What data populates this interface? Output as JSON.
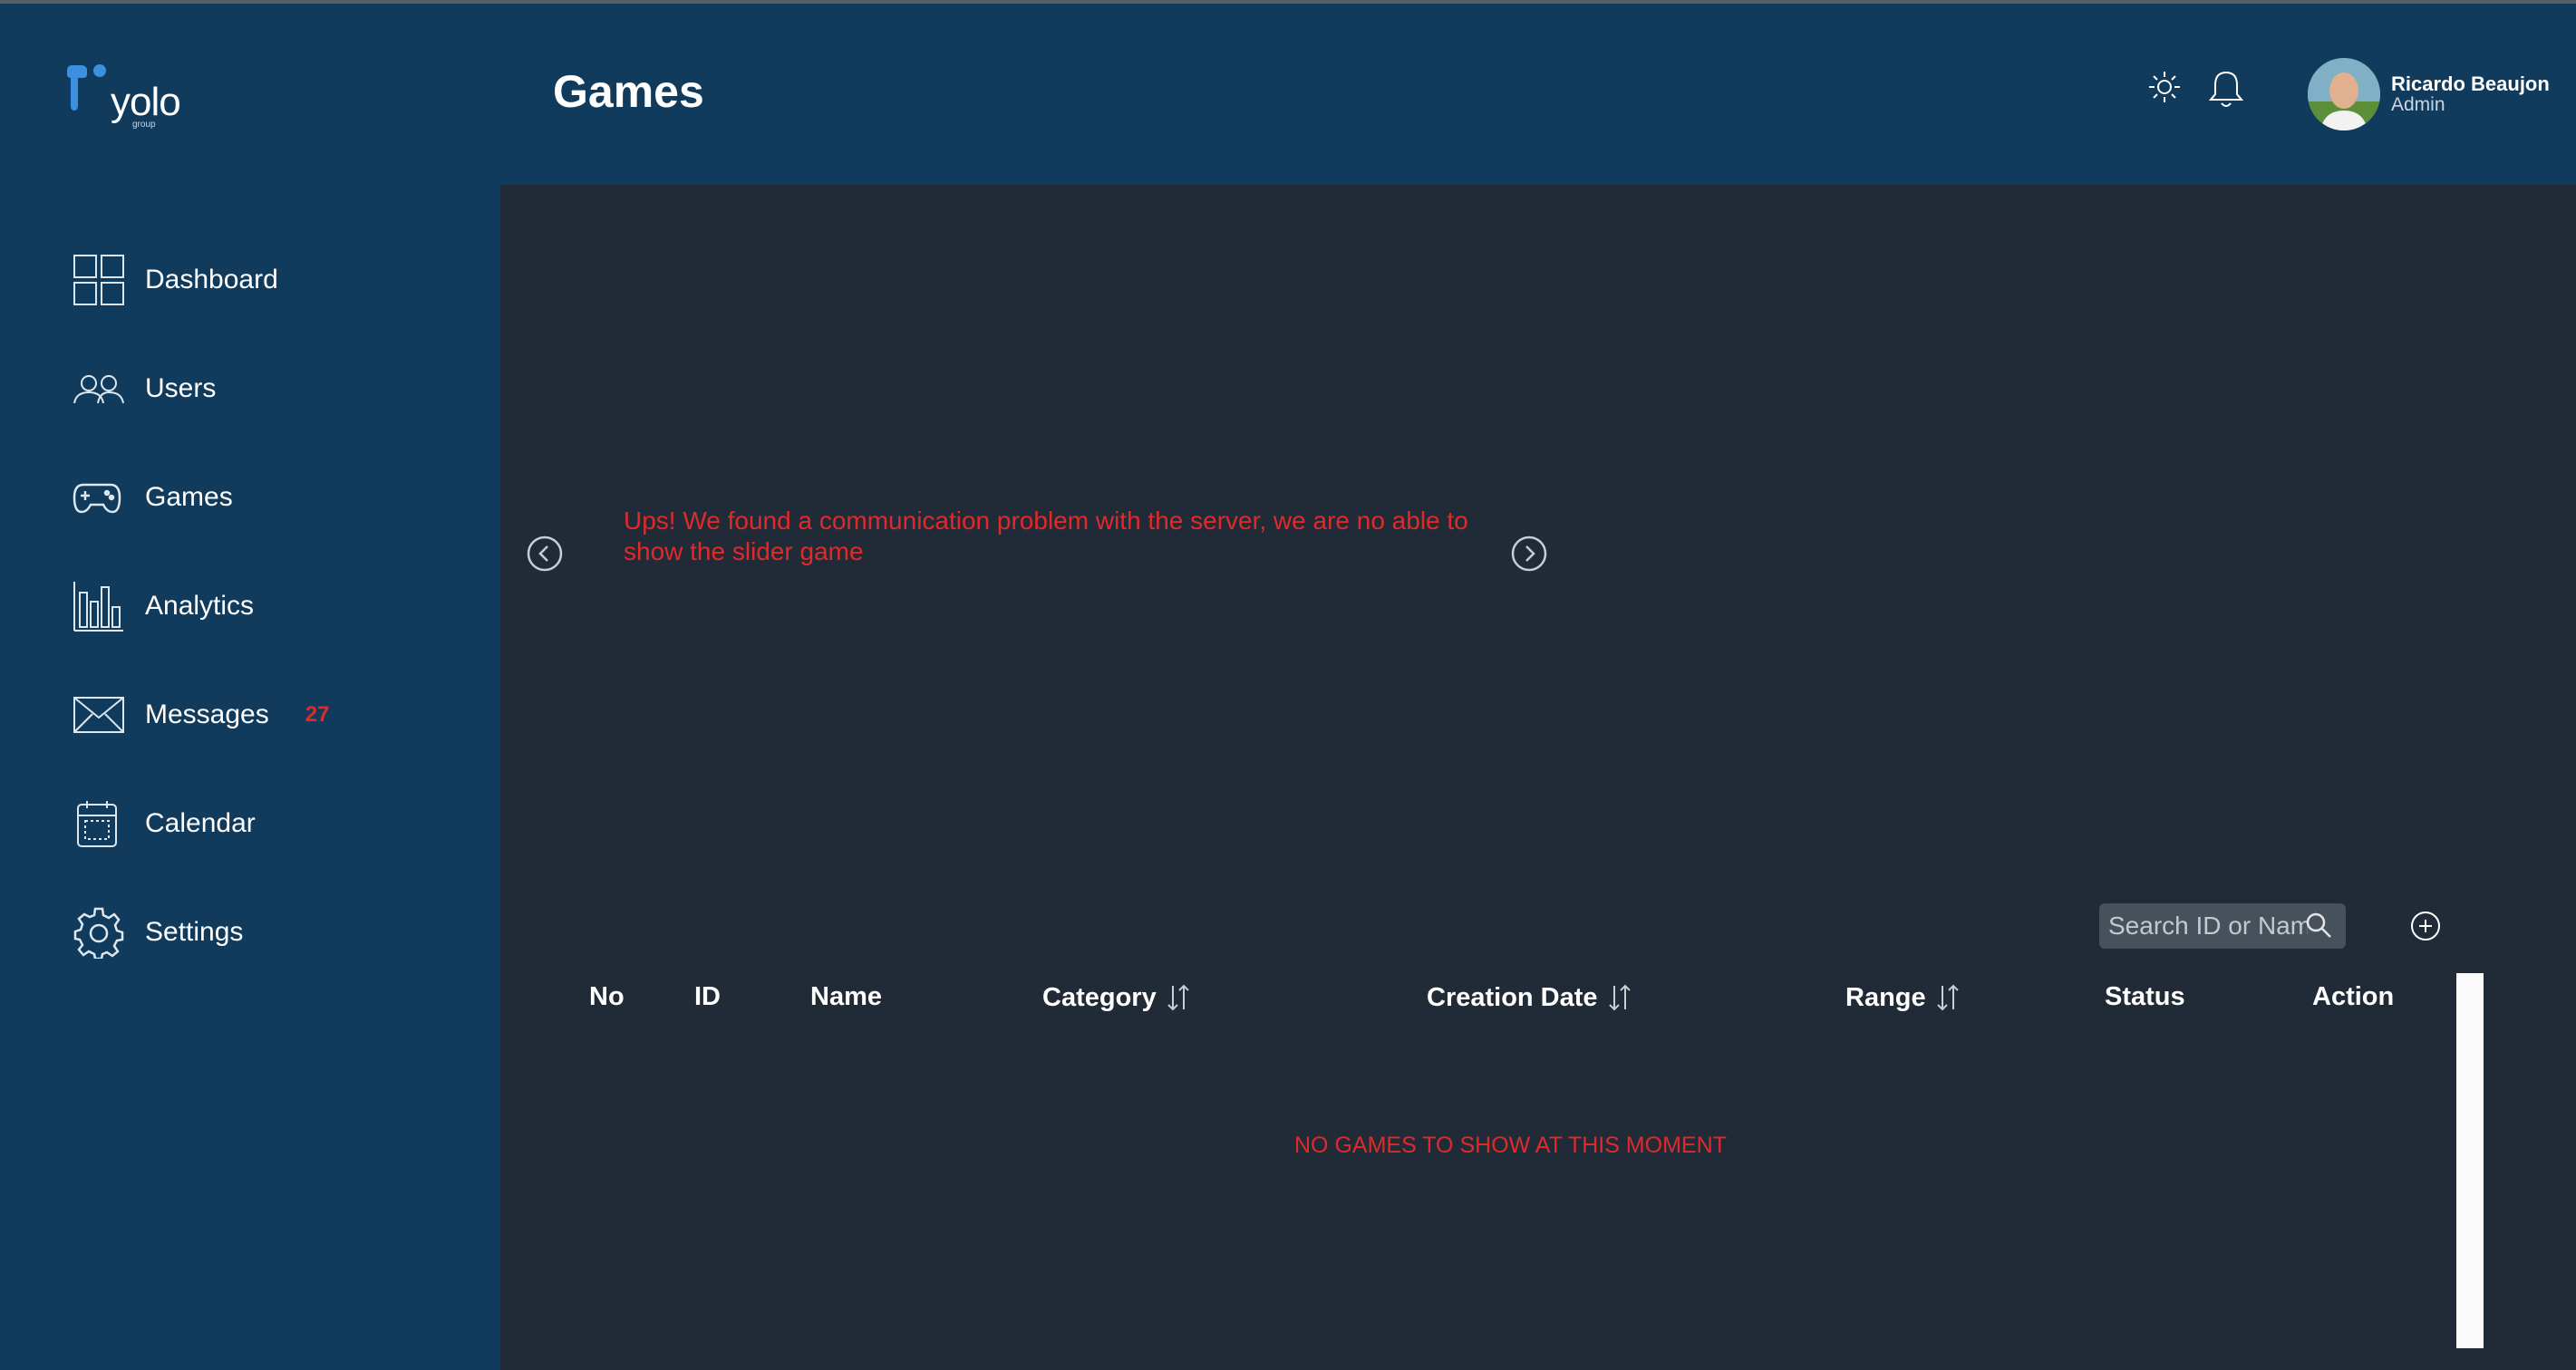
{
  "brand": {
    "name": "yolo",
    "sub": "group",
    "accent": "#3d8fe0"
  },
  "colors": {
    "sidebar": "#113b5c",
    "content": "#202b37",
    "error": "#e02a2a"
  },
  "header": {
    "title": "Games",
    "theme_icon": "sun-icon",
    "notification_icon": "bell-icon",
    "user": {
      "name": "Ricardo Beaujon",
      "role": "Admin"
    }
  },
  "sidebar": {
    "items": [
      {
        "label": "Dashboard",
        "icon": "dashboard-grid-icon"
      },
      {
        "label": "Users",
        "icon": "users-icon"
      },
      {
        "label": "Games",
        "icon": "gamepad-icon"
      },
      {
        "label": "Analytics",
        "icon": "analytics-bars-icon"
      },
      {
        "label": "Messages",
        "icon": "envelope-icon",
        "badge": "27"
      },
      {
        "label": "Calendar",
        "icon": "calendar-icon"
      },
      {
        "label": "Settings",
        "icon": "gear-icon"
      }
    ]
  },
  "slider": {
    "error": "Ups! We found a communication problem with the server, we are no able to show the slider game"
  },
  "toolbar": {
    "search_placeholder": "Search ID or Name"
  },
  "table": {
    "columns": [
      "No",
      "ID",
      "Name",
      "Category",
      "Creation Date",
      "Range",
      "Status",
      "Action"
    ],
    "empty_message": "NO GAMES TO SHOW AT THIS MOMENT"
  }
}
